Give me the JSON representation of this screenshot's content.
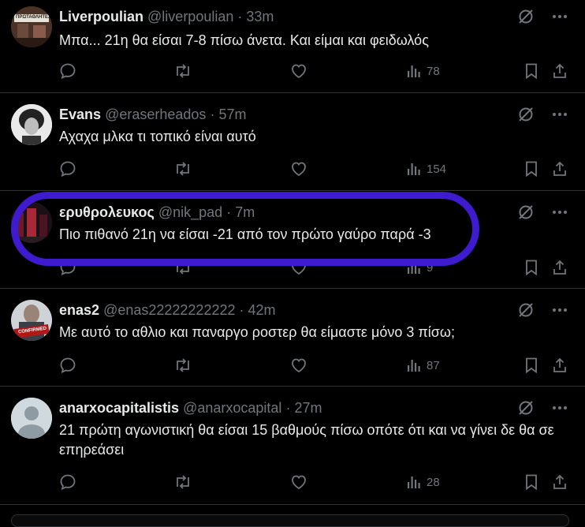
{
  "tweets": [
    {
      "name": "Liverpoulian",
      "handle": "@liverpoulian",
      "time": "33m",
      "text": "Μπα... 21η θα είσαι 7-8 πίσω άνετα. Και είμαι και φειδωλός",
      "views": "78",
      "avatar_label": "ΠΡΩΤΑΘΛΗΤΕΣ"
    },
    {
      "name": "Evans",
      "handle": "@eraserheados",
      "time": "57m",
      "text": "Αχαχα μλκα τι τοπικό είναι αυτό",
      "views": "154"
    },
    {
      "name": "ερυθρολευκος",
      "handle": "@nik_pad",
      "time": "7m",
      "text": "Πιο πιθανό 21η να είσαι -21 από τον πρώτο γαύρο παρά -3",
      "views": "9"
    },
    {
      "name": "enas2",
      "handle": "@enas22222222222",
      "time": "42m",
      "text": "Με αυτό το αθλιο και παναργο ροστερ θα είμαστε μόνο 3 πίσω;",
      "views": "87",
      "avatar_label": "CONFIRMED"
    },
    {
      "name": "anarxocapitalistis",
      "handle": "@anarxocapital",
      "time": "27m",
      "text": "21 πρώτη αγωνιστική θα είσαι 15 βαθμούς πίσω οπότε ότι και να γίνει δε θα σε επηρεάσει",
      "views": "28"
    }
  ],
  "separator": "·",
  "colors": {
    "background": "#000000",
    "text": "#e7e9ea",
    "muted": "#71767b",
    "border": "#2f3336",
    "highlight": "#3f1bd0"
  },
  "icons": [
    "grok-icon",
    "more-icon",
    "reply-icon",
    "retweet-icon",
    "like-icon",
    "views-icon",
    "bookmark-icon",
    "share-icon"
  ]
}
